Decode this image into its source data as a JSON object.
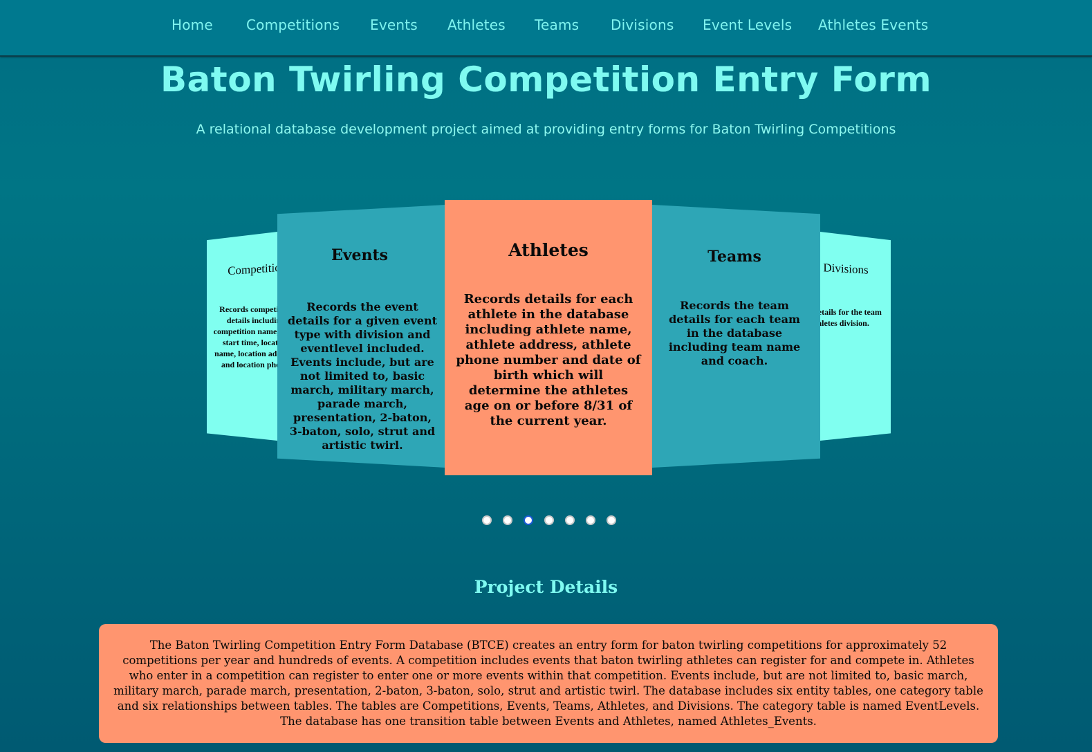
{
  "nav": {
    "items": [
      {
        "label": "Home"
      },
      {
        "label": "Competitions"
      },
      {
        "label": "Events"
      },
      {
        "label": "Athletes"
      },
      {
        "label": "Teams"
      },
      {
        "label": "Divisions"
      },
      {
        "label": "Event Levels"
      },
      {
        "label": "Athletes Events"
      }
    ]
  },
  "header": {
    "title": "Baton Twirling Competition Entry Form",
    "subtitle": "A relational database development project aimed at providing entry forms for Baton Twirling Competitions"
  },
  "carousel": {
    "panels": [
      {
        "title": "Competitions",
        "description": "Records competition details including competition name, date, start time, location name, location address, and location phone."
      },
      {
        "title": "Events",
        "description": "Records the event details for a given event type with division and eventlevel included. Events include, but are not limited to, basic march, military march, parade march, presentation, 2-baton, 3-baton, solo, strut and artistic twirl."
      },
      {
        "title": "Athletes",
        "description": "Records details for each athlete in the database including athlete name, athlete address, athlete phone number and date of birth which will determine the athletes age on or before 8/31 of the current year."
      },
      {
        "title": "Teams",
        "description": "Records the team details for each team in the database including team name and coach."
      },
      {
        "title": "Divisions",
        "description": "Records details for the team and athletes division."
      }
    ],
    "dot_count": 7,
    "active_index": 2
  },
  "details": {
    "title": "Project Details",
    "text": "The Baton Twirling Competition Entry Form Database (BTCE) creates an entry form for baton twirling competitions for approximately 52 competitions per year and hundreds of events. A competition includes events that baton twirling athletes can register for and compete in. Athletes who enter in a competition can register to enter one or more events within that competition. Events include, but are not limited to, basic march, military march, parade march, presentation, 2-baton, 3-baton, solo, strut and artistic twirl. The database includes six entity tables, one category table and six relationships between tables. The tables are Competitions, Events, Teams, Athletes, and Divisions. The category table is named EventLevels. The database has one transition table between Events and Athletes, named Athletes_Events."
  },
  "colors": {
    "background": "#00697c",
    "navbar": "#00798f",
    "accent_text": "#7ffaf1",
    "panel_center": "#ff956f",
    "panel_side": "#2ea6b6",
    "panel_far": "#80fff0",
    "active_dot": "#1a5ad8"
  }
}
